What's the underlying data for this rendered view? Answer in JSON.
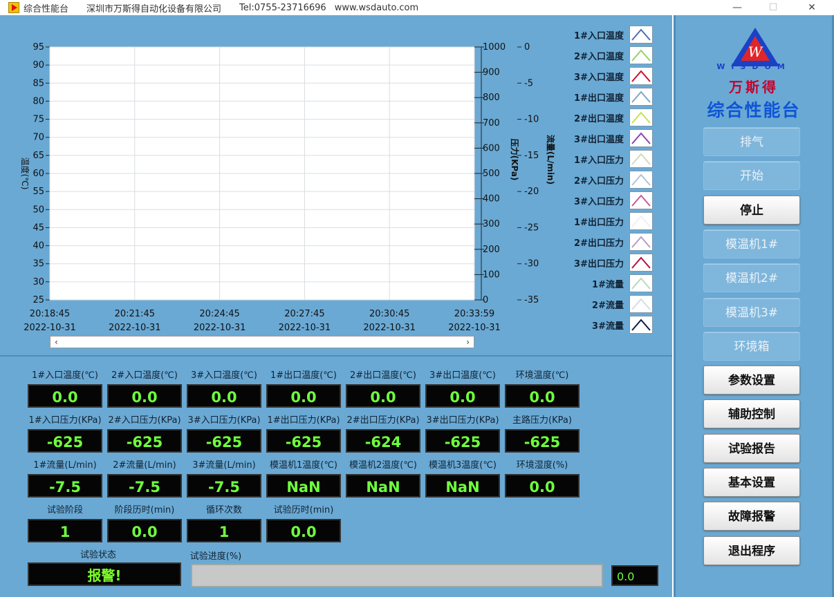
{
  "titlebar": {
    "app_name": "综合性能台",
    "company": "深圳市万斯得自动化设备有限公司",
    "phone": "Tel:0755-23716696",
    "website": "www.wsdauto.com",
    "minimize": "—",
    "maximize": "☐",
    "close": "✕"
  },
  "chart_data": {
    "type": "line",
    "x_ticks": [
      {
        "time": "20:18:45",
        "date": "2022-10-31"
      },
      {
        "time": "20:21:45",
        "date": "2022-10-31"
      },
      {
        "time": "20:24:45",
        "date": "2022-10-31"
      },
      {
        "time": "20:27:45",
        "date": "2022-10-31"
      },
      {
        "time": "20:30:45",
        "date": "2022-10-31"
      },
      {
        "time": "20:33:59",
        "date": "2022-10-31"
      }
    ],
    "y_left": {
      "label": "温度(℃)",
      "ticks": [
        95,
        90,
        85,
        80,
        75,
        70,
        65,
        60,
        55,
        50,
        45,
        40,
        35,
        30,
        25
      ],
      "range": [
        25,
        95
      ]
    },
    "y_pressure": {
      "label": "压力(KPa)",
      "ticks": [
        1000,
        900,
        800,
        700,
        600,
        500,
        400,
        300,
        200,
        100,
        0
      ],
      "range": [
        0,
        1000
      ]
    },
    "y_flow": {
      "label": "流量(L/min)",
      "ticks": [
        -35,
        -30,
        -25,
        -20,
        -15,
        -10,
        -5,
        0
      ],
      "range": [
        -35,
        0
      ]
    },
    "grid": true,
    "series": [
      {
        "name": "1#入口温度",
        "color": "#4a6fb3"
      },
      {
        "name": "2#入口温度",
        "color": "#8fd36f"
      },
      {
        "name": "3#入口温度",
        "color": "#c8102e"
      },
      {
        "name": "1#出口温度",
        "color": "#7fa5c8"
      },
      {
        "name": "2#出口温度",
        "color": "#c9e04a"
      },
      {
        "name": "3#出口温度",
        "color": "#8f3fb0"
      },
      {
        "name": "1#入口压力",
        "color": "#d4d9b8"
      },
      {
        "name": "2#入口压力",
        "color": "#b3c3d6"
      },
      {
        "name": "3#入口压力",
        "color": "#c45a9a"
      },
      {
        "name": "1#出口压力",
        "color": "#eef0f2"
      },
      {
        "name": "2#出口压力",
        "color": "#b79ac7"
      },
      {
        "name": "3#出口压力",
        "color": "#b0143c"
      },
      {
        "name": "1#流量",
        "color": "#b8d8c0"
      },
      {
        "name": "2#流量",
        "color": "#d5dde4"
      },
      {
        "name": "3#流量",
        "color": "#0a1a4a"
      }
    ]
  },
  "scrollbar": {
    "left_arrow": "‹",
    "right_arrow": "›"
  },
  "indicators": {
    "row1": [
      {
        "label": "1#入口温度(℃)",
        "value": "0.0"
      },
      {
        "label": "2#入口温度(℃)",
        "value": "0.0"
      },
      {
        "label": "3#入口温度(℃)",
        "value": "0.0"
      },
      {
        "label": "1#出口温度(℃)",
        "value": "0.0"
      },
      {
        "label": "2#出口温度(℃)",
        "value": "0.0"
      },
      {
        "label": "3#出口温度(℃)",
        "value": "0.0"
      },
      {
        "label": "环境温度(℃)",
        "value": "0.0"
      }
    ],
    "row2": [
      {
        "label": "1#入口压力(KPa)",
        "value": "-625"
      },
      {
        "label": "2#入口压力(KPa)",
        "value": "-625"
      },
      {
        "label": "3#入口压力(KPa)",
        "value": "-625"
      },
      {
        "label": "1#出口压力(KPa)",
        "value": "-625"
      },
      {
        "label": "2#出口压力(KPa)",
        "value": "-624"
      },
      {
        "label": "3#出口压力(KPa)",
        "value": "-625"
      },
      {
        "label": "主路压力(KPa)",
        "value": "-625"
      }
    ],
    "row3": [
      {
        "label": "1#流量(L/min)",
        "value": "-7.5"
      },
      {
        "label": "2#流量(L/min)",
        "value": "-7.5"
      },
      {
        "label": "3#流量(L/min)",
        "value": "-7.5"
      },
      {
        "label": "模温机1温度(℃)",
        "value": "NaN"
      },
      {
        "label": "模温机2温度(℃)",
        "value": "NaN"
      },
      {
        "label": "模温机3温度(℃)",
        "value": "NaN"
      },
      {
        "label": "环境湿度(%)",
        "value": "0.0"
      }
    ],
    "row4": [
      {
        "label": "试验阶段",
        "value": "1"
      },
      {
        "label": "阶段历时(min)",
        "value": "0.0"
      },
      {
        "label": "循环次数",
        "value": "1"
      },
      {
        "label": "试验历时(min)",
        "value": "0.0"
      }
    ]
  },
  "status": {
    "label": "试验状态",
    "value": "报警!"
  },
  "progress": {
    "label": "试验进度(%)",
    "value": "0.0",
    "fraction": 0
  },
  "sidebar": {
    "logo_letter": "W",
    "brand_en": "WISDOM",
    "brand_cn": "万斯得",
    "title": "综合性能台",
    "buttons": [
      {
        "label": "排气",
        "enabled": false
      },
      {
        "label": "开始",
        "enabled": false
      },
      {
        "label": "停止",
        "enabled": true
      },
      {
        "label": "模温机1#",
        "enabled": false
      },
      {
        "label": "模温机2#",
        "enabled": false
      },
      {
        "label": "模温机3#",
        "enabled": false
      },
      {
        "label": "环境箱",
        "enabled": false
      },
      {
        "label": "参数设置",
        "enabled": true
      },
      {
        "label": "辅助控制",
        "enabled": true
      },
      {
        "label": "试验报告",
        "enabled": true
      },
      {
        "label": "基本设置",
        "enabled": true
      },
      {
        "label": "故障报警",
        "enabled": true
      },
      {
        "label": "退出程序",
        "enabled": true
      }
    ]
  }
}
